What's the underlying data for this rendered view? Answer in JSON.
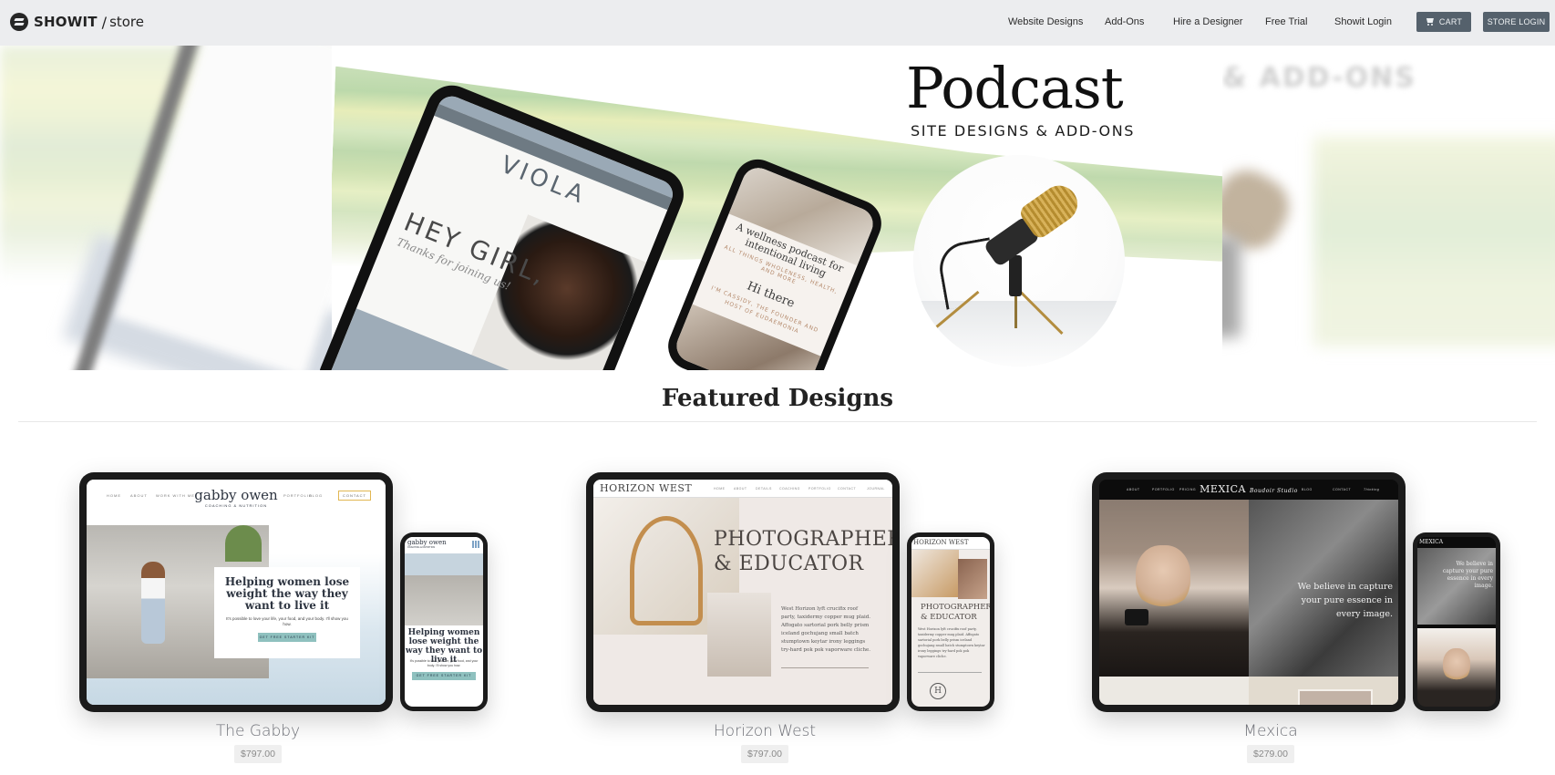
{
  "nav": {
    "brand": "SHOWIT",
    "slash": "/",
    "store": "store",
    "links": [
      "Website Designs",
      "Add-Ons",
      "Hire a Designer",
      "Free Trial",
      "Showit Login"
    ],
    "cart_label": "CART",
    "store_login_label": "STORE LOGIN"
  },
  "hero": {
    "title": "Podcast",
    "subtitle": "SITE DESIGNS & ADD-ONS",
    "blurred_text": "& ADD-ONS",
    "tablet": {
      "brand": "VIOLA",
      "headline": "HEY GIRL,",
      "tagline": "Thanks for joining us!"
    },
    "phone": {
      "headline": "A wellness podcast for intentional living",
      "tag": "ALL THINGS WHOLENESS, HEALTH, AND MORE",
      "greeting": "Hi there",
      "intro": "I'M CASSIDY, THE FOUNDER AND HOST OF EUDAEMONIA"
    }
  },
  "featured": {
    "title": "Featured Designs",
    "cards": [
      {
        "name": "The Gabby",
        "price": "$797.00",
        "preview": {
          "nav_left": [
            "HOME",
            "ABOUT",
            "WORK WITH ME"
          ],
          "nav_right": [
            "PORTFOLIO",
            "BLOG"
          ],
          "contact": "CONTACT",
          "logo": "gabby owen",
          "logo_sub": "COACHING & NUTRITION",
          "headline": "Helping women lose weight the way they want to live it",
          "body": "It's possible to love your life, your food, and your body. I'll show you how.",
          "cta": "GET FREE STARTER KIT"
        }
      },
      {
        "name": "Horizon West",
        "price": "$797.00",
        "preview": {
          "logo": "HORIZON WEST",
          "nav": [
            "HOME",
            "ABOUT",
            "DETAILS",
            "COACHING",
            "PORTFOLIO",
            "CONTACT",
            "JOURNAL"
          ],
          "headline": "PHOTOGRAPHER & EDUCATOR",
          "body": "West Horizon lyft crucifix roof party, taxidermy copper mug plaid. Affogato sartorial pork belly prism iceland gochujang small batch stumptown keytar irony leggings try-hard pok pok vaporware cliche.",
          "monogram": "H"
        }
      },
      {
        "name": "Mexica",
        "price": "$279.00",
        "preview": {
          "logo": "MEXICA",
          "logo_script": "Boudoir Studio",
          "nav_left": [
            "ABOUT",
            "PORTFOLIO",
            "PRICING"
          ],
          "nav_right": [
            "BLOG",
            "CONTACT"
          ],
          "nav_script": "Thinking",
          "quote": "We believe in capture your pure essence in every image."
        }
      }
    ]
  }
}
